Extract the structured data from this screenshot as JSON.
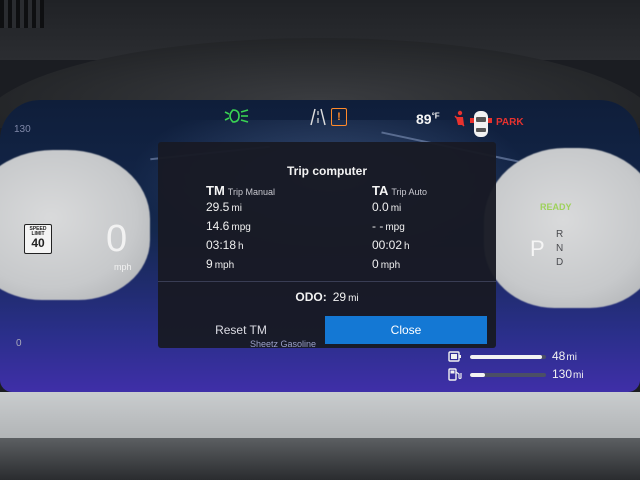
{
  "status": {
    "temperature": "89",
    "temperature_unit": "°F",
    "gear_state": "PARK",
    "icons": [
      "headlight-icon",
      "lane-road-icon",
      "warning-icon",
      "seatbelt-icon",
      "car-top-icon"
    ],
    "warning_symbol": "!"
  },
  "left_gauge": {
    "speed_limit_label": "SPEED LIMIT",
    "speed_limit": "40",
    "speed": "0",
    "speed_unit": "mph",
    "scale_top": "130",
    "scale_bottom": "0"
  },
  "right_gauge": {
    "ready": "READY",
    "selected_gear": "P",
    "gears": [
      "R",
      "N",
      "D"
    ]
  },
  "trip_computer": {
    "title": "Trip computer",
    "manual": {
      "abbr": "TM",
      "name": "Trip Manual",
      "distance": "29.5",
      "distance_unit": "mi",
      "economy": "14.6",
      "economy_unit": "mpg",
      "time": "03:18",
      "time_unit": "h",
      "speed": "9",
      "speed_unit": "mph"
    },
    "auto": {
      "abbr": "TA",
      "name": "Trip Auto",
      "distance": "0.0",
      "distance_unit": "mi",
      "economy": "- -",
      "economy_unit": "mpg",
      "time": "00:02",
      "time_unit": "h",
      "speed": "0",
      "speed_unit": "mph"
    },
    "odo_label": "ODO:",
    "odo_value": "29",
    "odo_unit": "mi",
    "reset_label": "Reset TM",
    "close_label": "Close"
  },
  "map": {
    "street": "Sheetz Gasoline"
  },
  "range": {
    "electric_value": "48",
    "electric_unit": "mi",
    "electric_fill": 0.95,
    "fuel_value": "130",
    "fuel_unit": "mi",
    "fuel_fill": 0.2
  },
  "colors": {
    "accent_button": "#1478d4",
    "ready_green": "#9ed15b",
    "park_red": "#e8322e",
    "warning_orange": "#ff8a2a",
    "headlight_green": "#39d353"
  }
}
